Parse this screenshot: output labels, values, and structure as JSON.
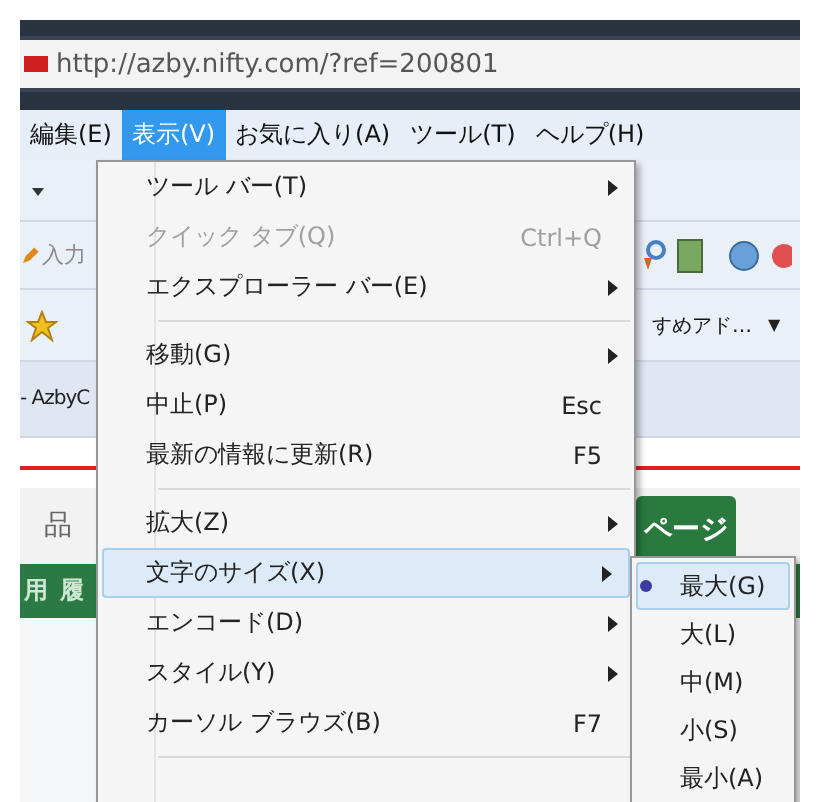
{
  "address_bar": {
    "url": "http://azby.nifty.com/?ref=200801"
  },
  "menu_bar": [
    {
      "label": "編集(E)",
      "selected": false
    },
    {
      "label": "表示(V)",
      "selected": true
    },
    {
      "label": "お気に入り(A)",
      "selected": false
    },
    {
      "label": "ツール(T)",
      "selected": false
    },
    {
      "label": "ヘルプ(H)",
      "selected": false
    }
  ],
  "search_field": {
    "placeholder": "入力"
  },
  "favorites_bar": {
    "link": "すめアド…",
    "dropdown": "▼"
  },
  "tab": {
    "title": "- AzbyC"
  },
  "page": {
    "nav_label": "品",
    "green_bar": "用 履",
    "tab_label": "ページ"
  },
  "view_menu": {
    "items": [
      {
        "kind": "item",
        "label": "ツール バー(T)",
        "has_submenu": true,
        "disabled": false,
        "highlighted": false
      },
      {
        "kind": "item",
        "label": "クイック タブ(Q)",
        "shortcut": "Ctrl+Q",
        "has_submenu": false,
        "disabled": true,
        "highlighted": false
      },
      {
        "kind": "item",
        "label": "エクスプローラー バー(E)",
        "has_submenu": true,
        "disabled": false,
        "highlighted": false
      },
      {
        "kind": "separator"
      },
      {
        "kind": "item",
        "label": "移動(G)",
        "has_submenu": true,
        "disabled": false,
        "highlighted": false
      },
      {
        "kind": "item",
        "label": "中止(P)",
        "shortcut": "Esc",
        "has_submenu": false,
        "disabled": false,
        "highlighted": false
      },
      {
        "kind": "item",
        "label": "最新の情報に更新(R)",
        "shortcut": "F5",
        "has_submenu": false,
        "disabled": false,
        "highlighted": false
      },
      {
        "kind": "separator"
      },
      {
        "kind": "item",
        "label": "拡大(Z)",
        "has_submenu": true,
        "disabled": false,
        "highlighted": false
      },
      {
        "kind": "item",
        "label": "文字のサイズ(X)",
        "has_submenu": true,
        "disabled": false,
        "highlighted": true
      },
      {
        "kind": "item",
        "label": "エンコード(D)",
        "has_submenu": true,
        "disabled": false,
        "highlighted": false
      },
      {
        "kind": "item",
        "label": "スタイル(Y)",
        "has_submenu": true,
        "disabled": false,
        "highlighted": false
      },
      {
        "kind": "item",
        "label": "カーソル ブラウズ(B)",
        "shortcut": "F7",
        "has_submenu": false,
        "disabled": false,
        "highlighted": false
      },
      {
        "kind": "separator"
      }
    ]
  },
  "text_size_submenu": {
    "items": [
      {
        "label": "最大(G)",
        "selected": true
      },
      {
        "label": "大(L)",
        "selected": false
      },
      {
        "label": "中(M)",
        "selected": false
      },
      {
        "label": "小(S)",
        "selected": false
      },
      {
        "label": "最小(A)",
        "selected": false
      }
    ]
  }
}
